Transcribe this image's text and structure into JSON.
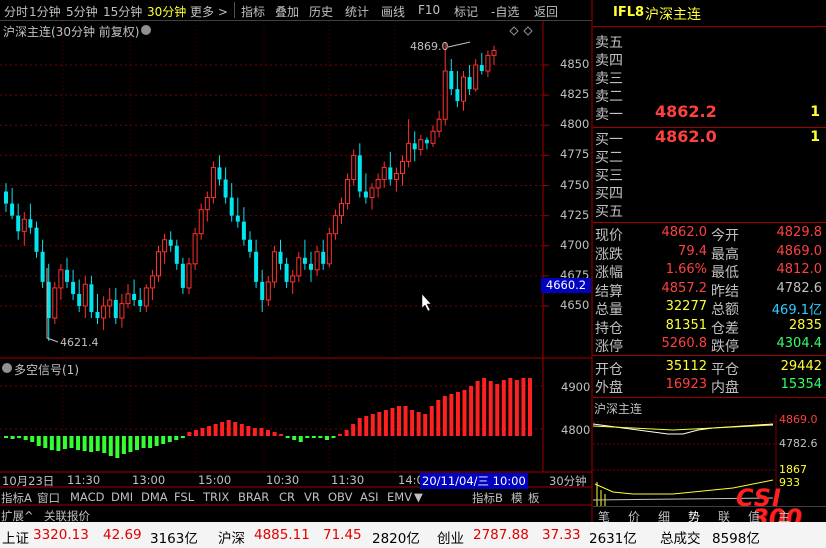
{
  "toolbar": {
    "periods": [
      "分时",
      "1分钟",
      "5分钟",
      "15分钟",
      "30分钟",
      "更多 >"
    ],
    "active_period": "30分钟",
    "buttons": [
      "指标",
      "叠加",
      "历史",
      "统计",
      "画线",
      "F10",
      "标记",
      "-自选",
      "返回"
    ]
  },
  "main_chart": {
    "title": "沪深主连(30分钟 前复权)",
    "price_labels": [
      "4850",
      "4825",
      "4800",
      "4775",
      "4750",
      "4725",
      "4700",
      "4675",
      "4650"
    ],
    "high_label": "4869.0",
    "low_label": "4621.4",
    "cursor_price": "4660.2"
  },
  "indicator": {
    "title": "多空信号(1)",
    "labels": [
      "4900",
      "4800"
    ]
  },
  "time_axis": {
    "labels": [
      "10月23日",
      "11:30",
      "13:00",
      "15:00",
      "10:30",
      "11:30",
      "14:00"
    ],
    "cursor_time": "20/11/04/三 10:00",
    "period": "30分钟"
  },
  "indicator_tabs": [
    "指标A",
    "窗口",
    "MACD",
    "DMI",
    "DMA",
    "FSL",
    "TRIX",
    "BRAR",
    "CR",
    "VR",
    "OBV",
    "ASI",
    "EMV",
    "▼",
    "指标B",
    "模",
    "板"
  ],
  "sub_tabs": [
    "扩展^",
    "关联报价"
  ],
  "quote": {
    "code": "IFL8",
    "name": "沪深主连",
    "asks": [
      {
        "label": "卖五",
        "price": "",
        "vol": ""
      },
      {
        "label": "卖四",
        "price": "",
        "vol": ""
      },
      {
        "label": "卖三",
        "price": "",
        "vol": ""
      },
      {
        "label": "卖二",
        "price": "",
        "vol": ""
      },
      {
        "label": "卖一",
        "price": "4862.2",
        "vol": "1"
      }
    ],
    "bids": [
      {
        "label": "买一",
        "price": "4862.0",
        "vol": "1"
      },
      {
        "label": "买二",
        "price": "",
        "vol": ""
      },
      {
        "label": "买三",
        "price": "",
        "vol": ""
      },
      {
        "label": "买四",
        "price": "",
        "vol": ""
      },
      {
        "label": "买五",
        "price": "",
        "vol": ""
      }
    ],
    "stats": [
      {
        "l1": "现价",
        "v1": "4862.0",
        "l2": "今开",
        "v2": "4829.8"
      },
      {
        "l1": "涨跌",
        "v1": "79.4",
        "l2": "最高",
        "v2": "4869.0"
      },
      {
        "l1": "涨幅",
        "v1": "1.66%",
        "l2": "最低",
        "v2": "4812.0"
      },
      {
        "l1": "结算",
        "v1": "4857.2",
        "l2": "昨结",
        "v2": "4782.6"
      },
      {
        "l1": "总量",
        "v1": "32277",
        "l2": "总额",
        "v2": "469.1亿"
      },
      {
        "l1": "持仓",
        "v1": "81351",
        "l2": "仓差",
        "v2": "2835"
      },
      {
        "l1": "涨停",
        "v1": "5260.8",
        "l2": "跌停",
        "v2": "4304.4"
      }
    ],
    "trade": [
      {
        "l1": "开仓",
        "v1": "35112",
        "l2": "平仓",
        "v2": "29442"
      },
      {
        "l1": "外盘",
        "v1": "16923",
        "l2": "内盘",
        "v2": "15354"
      }
    ]
  },
  "mini_chart": {
    "title": "沪深主连",
    "high": "4869.0",
    "mid": "4782.6",
    "vol_hi": "1867",
    "vol_lo": "933"
  },
  "bottom_tabs": [
    "笔",
    "价",
    "细",
    "势",
    "联",
    "值",
    "主"
  ],
  "logo": {
    "line1": "CSI",
    "line2": "300"
  },
  "status": {
    "sh_label": "上证",
    "sh_val": "3320.13",
    "sh_chg": "42.69",
    "sh_amt": "3163亿",
    "sz_label": "沪深",
    "sz_val": "4885.11",
    "sz_chg": "71.45",
    "sz_amt": "2820亿",
    "cy_label": "创业",
    "cy_val": "2787.88",
    "cy_chg": "37.33",
    "cy_amt": "2631亿",
    "total_label": "总成交",
    "total_val": "8598亿"
  },
  "colors": {
    "up": "#ff3030",
    "down": "#00e5ee",
    "green": "#33ff33",
    "accent": "#ff4040"
  }
}
